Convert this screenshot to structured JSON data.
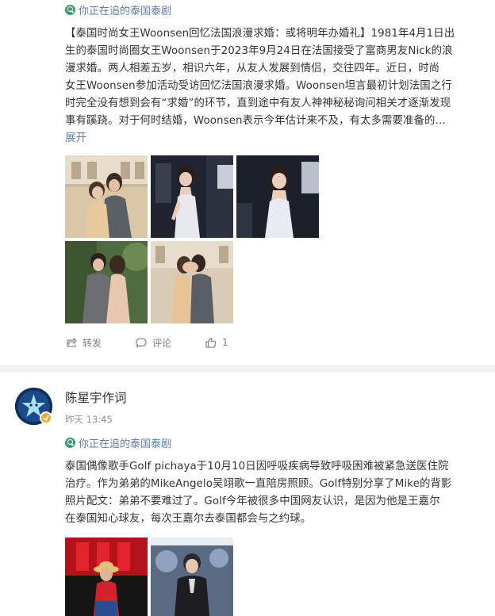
{
  "post1": {
    "topic": "你正在追的泰国泰剧",
    "text_lines": [
      "【泰国时尚女王Woonsen回忆法国浪漫求婚：或将明年办婚礼】1981年4月1日出",
      "生的泰国时尚圈女王Woonsen于2023年9月24日在法国接受了富商男友Nick的浪",
      "漫求婚。两人相差五岁，相识六年，从友人发展到情侣，交往四年。近日，时尚",
      "女王Woonsen参加活动受访回忆法国浪漫求婚。Woonsen坦言最初计划法国之行",
      "时完全没有想到会有“求婚”的环节，直到途中有友人神神秘秘询问相关才逐渐发现",
      "事有蹊跷。对于何时结婚，Woonsen表示今年估计来不及，有太多需要准备的…"
    ],
    "expand_label": "展开",
    "actions": {
      "repost_label": "转发",
      "comment_label": "评论",
      "like_count": "1"
    }
  },
  "post2": {
    "username": "陈星宇作词",
    "time": "昨天 13:45",
    "topic": "你正在追的泰国泰剧",
    "text_lines": [
      "泰国偶像歌手Golf pichaya于10月10日因呼吸疾病导致呼吸困难被紧急送医住院",
      "治疗。作为弟弟的MikeAngelo吴翊歌一直陪房照顾。Golf特别分享了Mike的背影",
      "照片配文：弟弟不要难过了。Golf今年被很多中国网友认识，是因为他是王嘉尔",
      "在泰国知心球友，每次王嘉尔去泰国都会与之约球。"
    ]
  },
  "colors": {
    "link": "#5f7fa6",
    "topic_icon": "#3a9d6d",
    "verified_badge": "#f5a623",
    "muted": "#808080"
  }
}
